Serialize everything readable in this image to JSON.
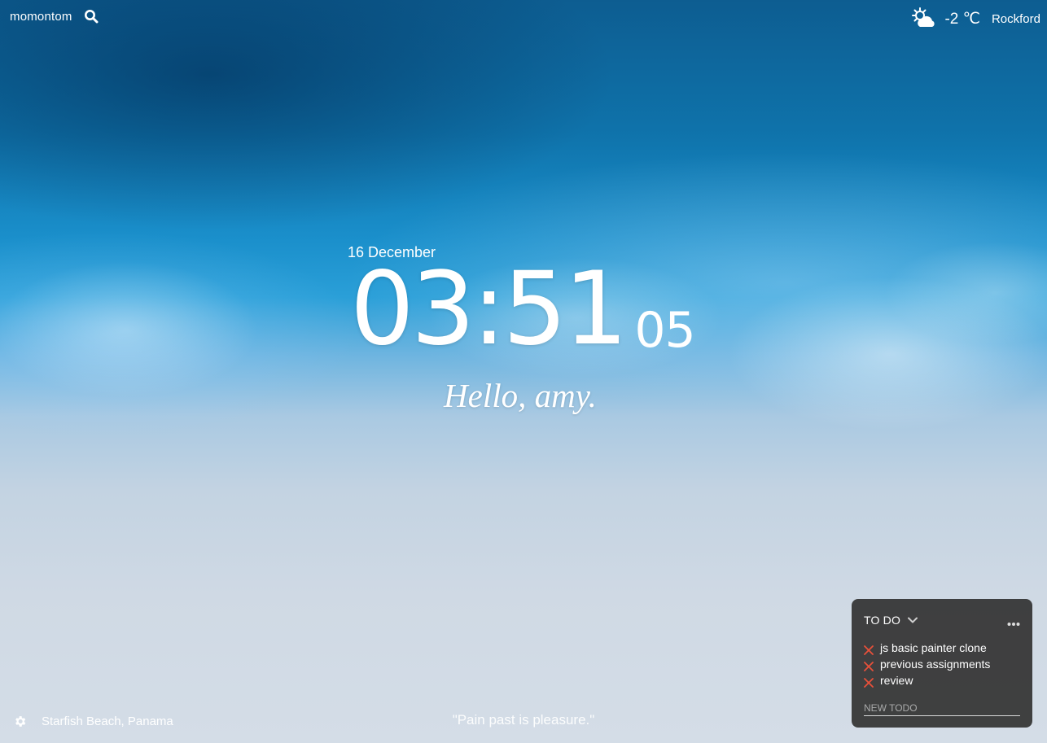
{
  "header": {
    "brand": "momontom",
    "search_icon": "search-icon"
  },
  "weather": {
    "icon": "partly-cloudy-sun-icon",
    "temperature": "-2 ℃",
    "city": "Rockford"
  },
  "clock": {
    "date": "16 December",
    "time": "03:51",
    "seconds": "05"
  },
  "greeting": "Hello, amy.",
  "footer": {
    "settings_icon": "gear-icon",
    "location": "Starfish Beach, Panama",
    "quote": "\"Pain past is pleasure.\""
  },
  "todo": {
    "title": "TO DO",
    "items": [
      {
        "label": "js basic painter clone"
      },
      {
        "label": "previous assignments"
      },
      {
        "label": "review"
      }
    ],
    "new_placeholder": "NEW TODO",
    "accent_color": "#e8503a"
  }
}
